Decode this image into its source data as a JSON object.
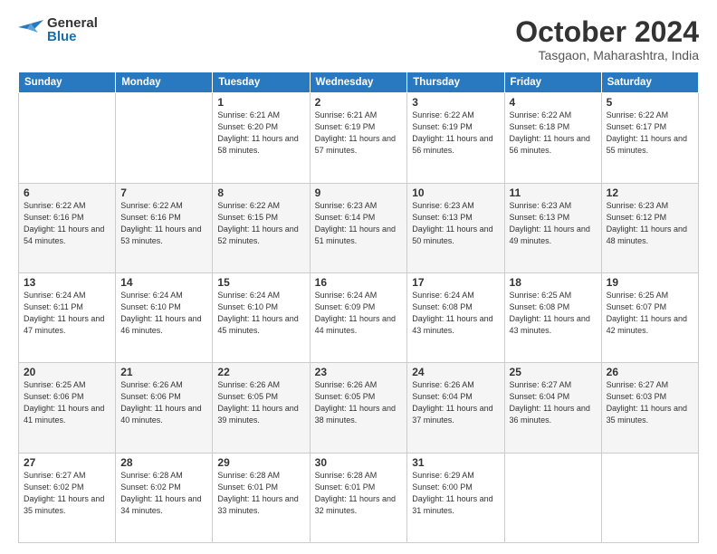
{
  "header": {
    "logo_general": "General",
    "logo_blue": "Blue",
    "month_title": "October 2024",
    "location": "Tasgaon, Maharashtra, India"
  },
  "days_of_week": [
    "Sunday",
    "Monday",
    "Tuesday",
    "Wednesday",
    "Thursday",
    "Friday",
    "Saturday"
  ],
  "weeks": [
    [
      {
        "num": "",
        "info": ""
      },
      {
        "num": "",
        "info": ""
      },
      {
        "num": "1",
        "info": "Sunrise: 6:21 AM\nSunset: 6:20 PM\nDaylight: 11 hours and 58 minutes."
      },
      {
        "num": "2",
        "info": "Sunrise: 6:21 AM\nSunset: 6:19 PM\nDaylight: 11 hours and 57 minutes."
      },
      {
        "num": "3",
        "info": "Sunrise: 6:22 AM\nSunset: 6:19 PM\nDaylight: 11 hours and 56 minutes."
      },
      {
        "num": "4",
        "info": "Sunrise: 6:22 AM\nSunset: 6:18 PM\nDaylight: 11 hours and 56 minutes."
      },
      {
        "num": "5",
        "info": "Sunrise: 6:22 AM\nSunset: 6:17 PM\nDaylight: 11 hours and 55 minutes."
      }
    ],
    [
      {
        "num": "6",
        "info": "Sunrise: 6:22 AM\nSunset: 6:16 PM\nDaylight: 11 hours and 54 minutes."
      },
      {
        "num": "7",
        "info": "Sunrise: 6:22 AM\nSunset: 6:16 PM\nDaylight: 11 hours and 53 minutes."
      },
      {
        "num": "8",
        "info": "Sunrise: 6:22 AM\nSunset: 6:15 PM\nDaylight: 11 hours and 52 minutes."
      },
      {
        "num": "9",
        "info": "Sunrise: 6:23 AM\nSunset: 6:14 PM\nDaylight: 11 hours and 51 minutes."
      },
      {
        "num": "10",
        "info": "Sunrise: 6:23 AM\nSunset: 6:13 PM\nDaylight: 11 hours and 50 minutes."
      },
      {
        "num": "11",
        "info": "Sunrise: 6:23 AM\nSunset: 6:13 PM\nDaylight: 11 hours and 49 minutes."
      },
      {
        "num": "12",
        "info": "Sunrise: 6:23 AM\nSunset: 6:12 PM\nDaylight: 11 hours and 48 minutes."
      }
    ],
    [
      {
        "num": "13",
        "info": "Sunrise: 6:24 AM\nSunset: 6:11 PM\nDaylight: 11 hours and 47 minutes."
      },
      {
        "num": "14",
        "info": "Sunrise: 6:24 AM\nSunset: 6:10 PM\nDaylight: 11 hours and 46 minutes."
      },
      {
        "num": "15",
        "info": "Sunrise: 6:24 AM\nSunset: 6:10 PM\nDaylight: 11 hours and 45 minutes."
      },
      {
        "num": "16",
        "info": "Sunrise: 6:24 AM\nSunset: 6:09 PM\nDaylight: 11 hours and 44 minutes."
      },
      {
        "num": "17",
        "info": "Sunrise: 6:24 AM\nSunset: 6:08 PM\nDaylight: 11 hours and 43 minutes."
      },
      {
        "num": "18",
        "info": "Sunrise: 6:25 AM\nSunset: 6:08 PM\nDaylight: 11 hours and 43 minutes."
      },
      {
        "num": "19",
        "info": "Sunrise: 6:25 AM\nSunset: 6:07 PM\nDaylight: 11 hours and 42 minutes."
      }
    ],
    [
      {
        "num": "20",
        "info": "Sunrise: 6:25 AM\nSunset: 6:06 PM\nDaylight: 11 hours and 41 minutes."
      },
      {
        "num": "21",
        "info": "Sunrise: 6:26 AM\nSunset: 6:06 PM\nDaylight: 11 hours and 40 minutes."
      },
      {
        "num": "22",
        "info": "Sunrise: 6:26 AM\nSunset: 6:05 PM\nDaylight: 11 hours and 39 minutes."
      },
      {
        "num": "23",
        "info": "Sunrise: 6:26 AM\nSunset: 6:05 PM\nDaylight: 11 hours and 38 minutes."
      },
      {
        "num": "24",
        "info": "Sunrise: 6:26 AM\nSunset: 6:04 PM\nDaylight: 11 hours and 37 minutes."
      },
      {
        "num": "25",
        "info": "Sunrise: 6:27 AM\nSunset: 6:04 PM\nDaylight: 11 hours and 36 minutes."
      },
      {
        "num": "26",
        "info": "Sunrise: 6:27 AM\nSunset: 6:03 PM\nDaylight: 11 hours and 35 minutes."
      }
    ],
    [
      {
        "num": "27",
        "info": "Sunrise: 6:27 AM\nSunset: 6:02 PM\nDaylight: 11 hours and 35 minutes."
      },
      {
        "num": "28",
        "info": "Sunrise: 6:28 AM\nSunset: 6:02 PM\nDaylight: 11 hours and 34 minutes."
      },
      {
        "num": "29",
        "info": "Sunrise: 6:28 AM\nSunset: 6:01 PM\nDaylight: 11 hours and 33 minutes."
      },
      {
        "num": "30",
        "info": "Sunrise: 6:28 AM\nSunset: 6:01 PM\nDaylight: 11 hours and 32 minutes."
      },
      {
        "num": "31",
        "info": "Sunrise: 6:29 AM\nSunset: 6:00 PM\nDaylight: 11 hours and 31 minutes."
      },
      {
        "num": "",
        "info": ""
      },
      {
        "num": "",
        "info": ""
      }
    ]
  ]
}
